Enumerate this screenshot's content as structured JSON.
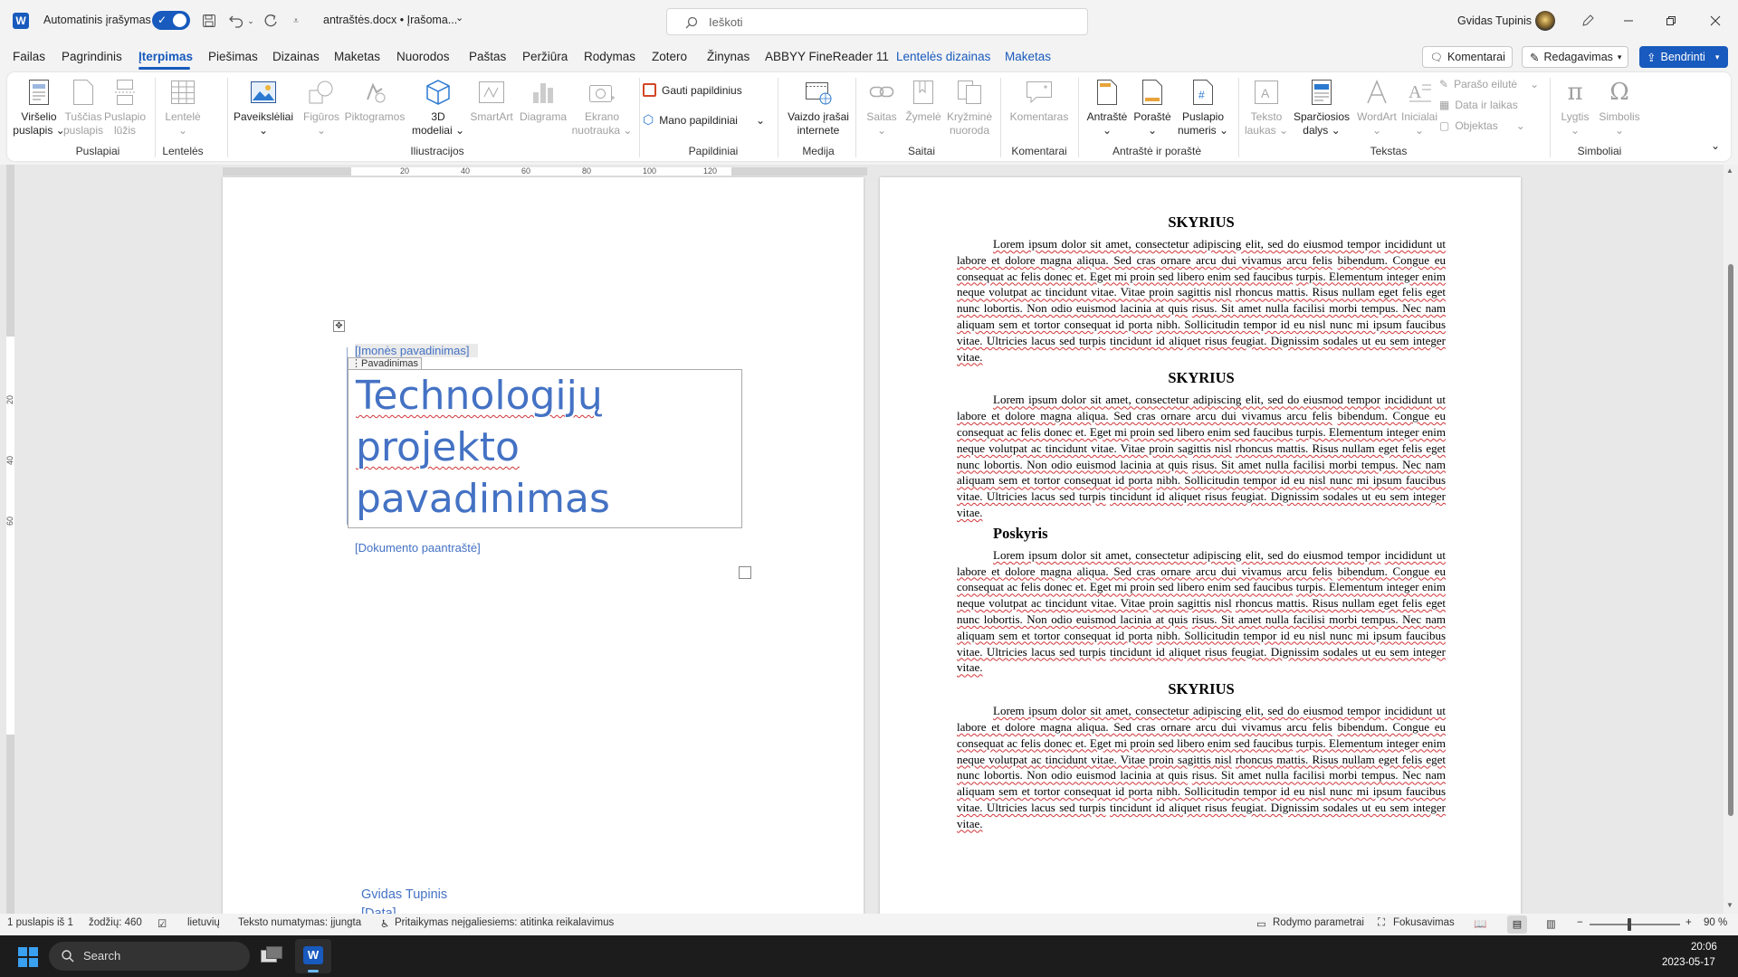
{
  "titlebar": {
    "autosave_label": "Automatinis įrašymas",
    "doc_title": "antraštės.docx • Įrašoma...",
    "search_placeholder": "Ieškoti",
    "user_name": "Gvidas Tupinis"
  },
  "menu": {
    "tabs": [
      "Failas",
      "Pagrindinis",
      "Įterpimas",
      "Piešimas",
      "Dizainas",
      "Maketas",
      "Nuorodos",
      "Paštas",
      "Peržiūra",
      "Rodymas",
      "Zotero",
      "Žinynas",
      "ABBYY FineReader 11",
      "Lentelės dizainas",
      "Maketas"
    ],
    "active_tab": "Įterpimas",
    "comments_btn": "Komentarai",
    "editing_btn": "Redagavimas",
    "share_btn": "Bendrinti"
  },
  "ribbon": {
    "groups": {
      "pages": "Puslapiai",
      "tables": "Lentelės",
      "illustrations": "Iliustracijos",
      "addins": "Papildiniai",
      "media": "Medija",
      "links": "Saitai",
      "comments": "Komentarai",
      "header_footer": "Antraštė ir poraštė",
      "text": "Tekstas",
      "symbols": "Simboliai"
    },
    "cover_page": [
      "Viršelio",
      "puslapis"
    ],
    "blank_page": [
      "Tuščias",
      "puslapis"
    ],
    "page_break": [
      "Puslapio",
      "lūžis"
    ],
    "table": "Lentelė",
    "pictures": "Paveikslėliai",
    "shapes": "Figūros",
    "icons": "Piktogramos",
    "models3d": [
      "3D",
      "modeliai"
    ],
    "smartart": "SmartArt",
    "chart": "Diagrama",
    "screenshot": [
      "Ekrano",
      "nuotrauka"
    ],
    "get_addins": "Gauti papildinius",
    "my_addins": "Mano papildiniai",
    "online_video": [
      "Vaizdo įrašai",
      "internete"
    ],
    "link": "Saitas",
    "bookmark": "Žymelė",
    "crossref": [
      "Kryžminė",
      "nuoroda"
    ],
    "comment": "Komentaras",
    "header": "Antraštė",
    "footer": "Poraštė",
    "page_number": [
      "Puslapio",
      "numeris"
    ],
    "text_box": [
      "Teksto",
      "laukas"
    ],
    "quick_parts": [
      "Sparčiosios",
      "dalys"
    ],
    "wordart": "WordArt",
    "dropcap": "Inicialai",
    "signature_line": "Parašo eilutė",
    "date_time": "Data ir laikas",
    "object": "Objektas",
    "equation": "Lygtis",
    "symbol": "Simbolis"
  },
  "ruler": {
    "marks": [
      "20",
      "40",
      "60",
      "80",
      "100",
      "120"
    ]
  },
  "vruler": {
    "marks": [
      "20",
      "40",
      "60"
    ]
  },
  "page1": {
    "company": "[Įmonės pavadinimas]",
    "title_tag": "Pavadinimas",
    "title_lines": [
      "Technologijų",
      "projekto",
      "pavadinimas"
    ],
    "subtitle": "[Dokumento paantraštė]",
    "author": "Gvidas Tupinis",
    "date": "[Data]"
  },
  "page2": {
    "sections": [
      {
        "heading": "SKYRIUS",
        "style": "center"
      },
      {
        "heading": "SKYRIUS",
        "style": "center"
      },
      {
        "heading": "Poskyris",
        "style": "left"
      },
      {
        "heading": "SKYRIUS",
        "style": "center"
      }
    ],
    "paragraph_lines": [
      "Lorem ipsum dolor sit amet, consectetur adipiscing elit, sed do eiusmod tempor",
      "incididunt ut labore et dolore magna aliqua. Sed cras ornare arcu dui vivamus arcu felis",
      "bibendum. Congue eu consequat ac felis donec et. Eget mi proin sed libero enim sed faucibus",
      "turpis. Elementum integer enim neque volutpat ac tincidunt vitae. Vitae proin sagittis nisl",
      "rhoncus mattis. Risus nullam eget felis eget nunc lobortis. Non odio euismod lacinia at quis",
      "risus. Sit amet nulla facilisi morbi tempus. Nec nam aliquam sem et tortor consequat id porta",
      "nibh. Sollicitudin tempor id eu nisl nunc mi ipsum faucibus vitae. Ultricies lacus sed turpis",
      "tincidunt id aliquet risus feugiat. Dignissim sodales ut eu sem integer vitae."
    ]
  },
  "status": {
    "page": "1 puslapis iš 1",
    "words": "žodžių: 460",
    "language": "lietuvių",
    "prediction": "Teksto numatymas: įjungta",
    "accessibility": "Pritaikymas neįgaliesiems: atitinka reikalavimus",
    "display_settings": "Rodymo parametrai",
    "focus": "Fokusavimas",
    "zoom": "90 %"
  },
  "taskbar": {
    "search": "Search",
    "time": "20:06",
    "date": "2023-05-17"
  },
  "colors": {
    "accent": "#185abd",
    "word_blue": "#2b579a",
    "title_blue": "#4472c4",
    "spell_red": "#d13438"
  }
}
